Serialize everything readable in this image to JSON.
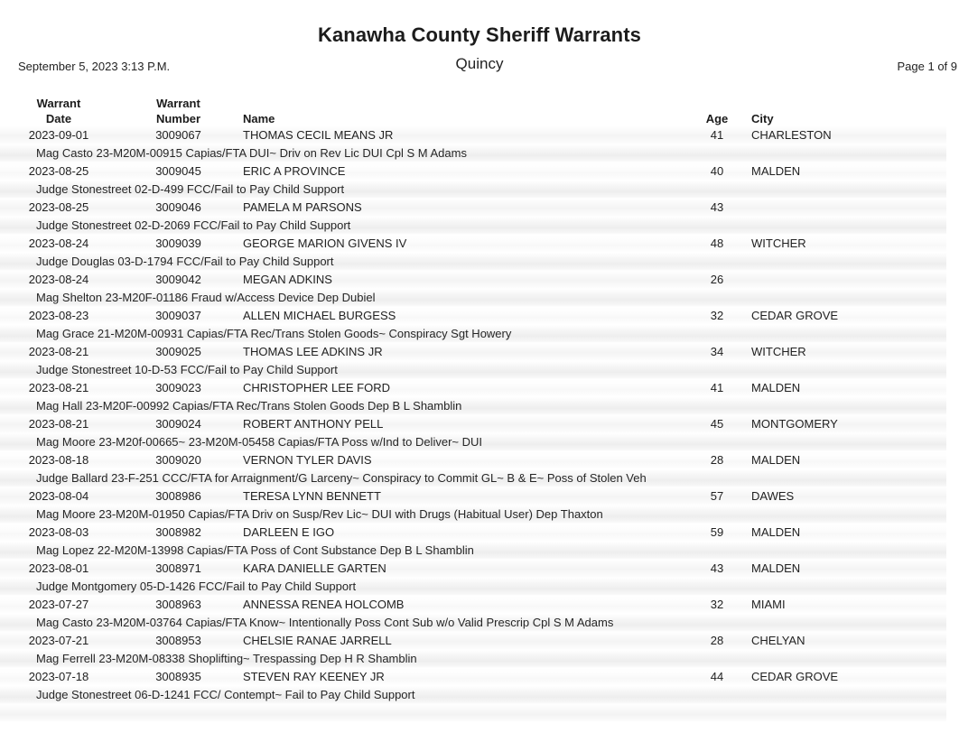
{
  "header": {
    "title": "Kanawha County Sheriff Warrants",
    "datetime": "September 5, 2023 3:13 P.M.",
    "subtitle": "Quincy",
    "page_indicator": "Page 1 of 9"
  },
  "table": {
    "columns": [
      {
        "key": "warrant_date",
        "line1": "Warrant",
        "line2": "Date"
      },
      {
        "key": "warrant_number",
        "line1": "Warrant",
        "line2": "Number"
      },
      {
        "key": "name",
        "line1": "",
        "line2": "Name"
      },
      {
        "key": "age",
        "line1": "",
        "line2": "Age"
      },
      {
        "key": "city",
        "line1": "",
        "line2": "City"
      }
    ],
    "rows": [
      {
        "warrant_date": "2023-09-01",
        "warrant_number": "3009067",
        "name": "THOMAS CECIL MEANS JR",
        "age": "41",
        "city": "CHARLESTON",
        "detail": "Mag Casto 23-M20M-00915 Capias/FTA DUI~ Driv on Rev Lic DUI Cpl S M Adams"
      },
      {
        "warrant_date": "2023-08-25",
        "warrant_number": "3009045",
        "name": "ERIC A PROVINCE",
        "age": "40",
        "city": "MALDEN",
        "detail": "Judge Stonestreet 02-D-499 FCC/Fail to Pay Child Support"
      },
      {
        "warrant_date": "2023-08-25",
        "warrant_number": "3009046",
        "name": "PAMELA M PARSONS",
        "age": "43",
        "city": "",
        "detail": "Judge Stonestreet 02-D-2069 FCC/Fail to Pay Child Support"
      },
      {
        "warrant_date": "2023-08-24",
        "warrant_number": "3009039",
        "name": "GEORGE MARION GIVENS IV",
        "age": "48",
        "city": "WITCHER",
        "detail": "Judge Douglas 03-D-1794 FCC/Fail to Pay Child Support"
      },
      {
        "warrant_date": "2023-08-24",
        "warrant_number": "3009042",
        "name": "MEGAN ADKINS",
        "age": "26",
        "city": "",
        "detail": "Mag Shelton 23-M20F-01186 Fraud w/Access Device Dep Dubiel"
      },
      {
        "warrant_date": "2023-08-23",
        "warrant_number": "3009037",
        "name": "ALLEN MICHAEL BURGESS",
        "age": "32",
        "city": "CEDAR GROVE",
        "detail": "Mag Grace 21-M20M-00931 Capias/FTA Rec/Trans Stolen Goods~ Conspiracy Sgt Howery"
      },
      {
        "warrant_date": "2023-08-21",
        "warrant_number": "3009025",
        "name": "THOMAS LEE ADKINS JR",
        "age": "34",
        "city": "WITCHER",
        "detail": "Judge Stonestreet 10-D-53 FCC/Fail to Pay Child Support"
      },
      {
        "warrant_date": "2023-08-21",
        "warrant_number": "3009023",
        "name": "CHRISTOPHER LEE FORD",
        "age": "41",
        "city": "MALDEN",
        "detail": "Mag Hall 23-M20F-00992 Capias/FTA Rec/Trans Stolen Goods Dep B L Shamblin"
      },
      {
        "warrant_date": "2023-08-21",
        "warrant_number": "3009024",
        "name": "ROBERT ANTHONY PELL",
        "age": "45",
        "city": "MONTGOMERY",
        "detail": "Mag Moore 23-M20f-00665~ 23-M20M-05458 Capias/FTA Poss w/Ind to Deliver~ DUI"
      },
      {
        "warrant_date": "2023-08-18",
        "warrant_number": "3009020",
        "name": "VERNON TYLER DAVIS",
        "age": "28",
        "city": "MALDEN",
        "detail": "Judge Ballard 23-F-251 CCC/FTA for Arraignment/G Larceny~ Conspiracy to Commit GL~ B & E~ Poss of Stolen Veh"
      },
      {
        "warrant_date": "2023-08-04",
        "warrant_number": "3008986",
        "name": "TERESA LYNN BENNETT",
        "age": "57",
        "city": "DAWES",
        "detail": "Mag Moore 23-M20M-01950 Capias/FTA Driv on Susp/Rev Lic~ DUI with Drugs (Habitual User) Dep Thaxton"
      },
      {
        "warrant_date": "2023-08-03",
        "warrant_number": "3008982",
        "name": "DARLEEN E IGO",
        "age": "59",
        "city": "MALDEN",
        "detail": "Mag Lopez 22-M20M-13998 Capias/FTA Poss of Cont Substance Dep B L Shamblin"
      },
      {
        "warrant_date": "2023-08-01",
        "warrant_number": "3008971",
        "name": "KARA DANIELLE GARTEN",
        "age": "43",
        "city": "MALDEN",
        "detail": "Judge Montgomery 05-D-1426 FCC/Fail to Pay Child Support"
      },
      {
        "warrant_date": "2023-07-27",
        "warrant_number": "3008963",
        "name": "ANNESSA RENEA HOLCOMB",
        "age": "32",
        "city": "MIAMI",
        "detail": "Mag Casto 23-M20M-03764 Capias/FTA Know~ Intentionally Poss Cont Sub w/o Valid Prescrip Cpl S M Adams"
      },
      {
        "warrant_date": "2023-07-21",
        "warrant_number": "3008953",
        "name": "CHELSIE RANAE JARRELL",
        "age": "28",
        "city": "CHELYAN",
        "detail": "Mag Ferrell 23-M20M-08338 Shoplifting~ Trespassing Dep H R Shamblin"
      },
      {
        "warrant_date": "2023-07-18",
        "warrant_number": "3008935",
        "name": "STEVEN RAY KEENEY JR",
        "age": "44",
        "city": "CEDAR GROVE",
        "detail": "Judge Stonestreet 06-D-1241 FCC/ Contempt~ Fail to Pay Child Support"
      }
    ]
  },
  "colors": {
    "text": "#222222",
    "title": "#1c1c1c",
    "band_light": "#f4f4f4",
    "band_lighter": "#f8f8f8",
    "page_background": "#ffffff"
  }
}
